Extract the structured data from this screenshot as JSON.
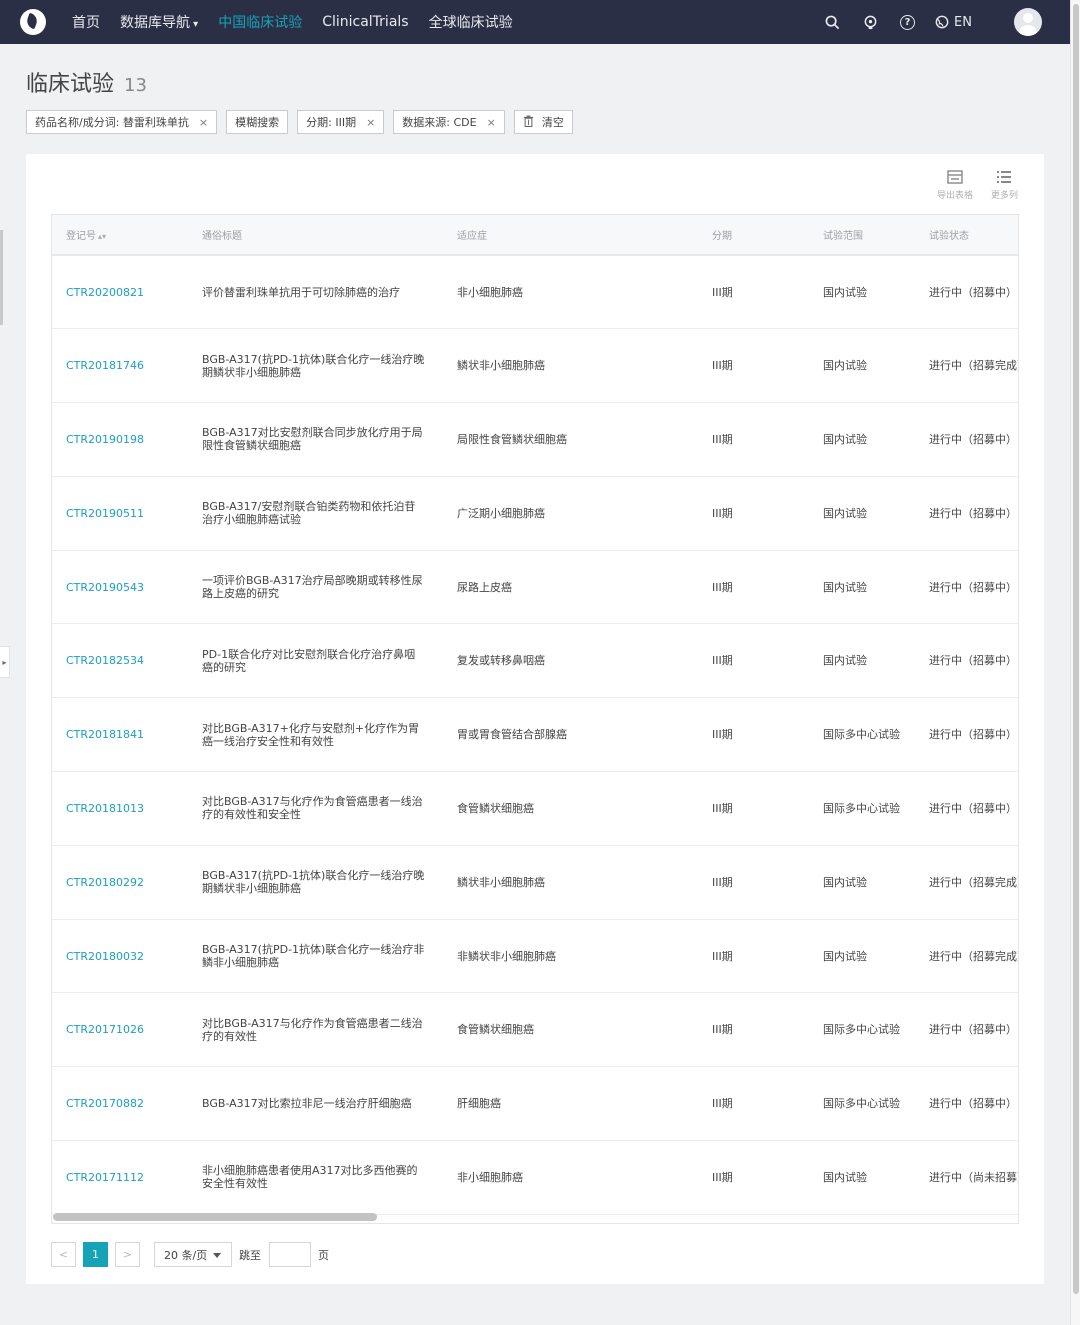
{
  "nav": {
    "items": [
      {
        "label": "首页",
        "active": false,
        "dropdown": false
      },
      {
        "label": "数据库导航",
        "active": false,
        "dropdown": true
      },
      {
        "label": "中国临床试验",
        "active": true,
        "dropdown": false
      },
      {
        "label": "ClinicalTrials",
        "active": false,
        "dropdown": false
      },
      {
        "label": "全球临床试验",
        "active": false,
        "dropdown": false
      }
    ],
    "lang_label": "EN",
    "icons": [
      "search-icon",
      "lightbulb-icon",
      "help-icon",
      "globe-icon",
      "avatar"
    ]
  },
  "page": {
    "title": "临床试验",
    "count": "13"
  },
  "filters": [
    {
      "label": "药品名称/成分词: 替雷利珠单抗",
      "removable": true
    },
    {
      "label": "模糊搜索",
      "removable": false
    },
    {
      "label": "分期: III期",
      "removable": true
    },
    {
      "label": "数据来源: CDE",
      "removable": true
    }
  ],
  "clear_label": "清空",
  "toolbar": {
    "export_label": "导出表格",
    "columns_label": "更多列"
  },
  "table": {
    "columns": [
      "登记号",
      "通俗标题",
      "适应症",
      "分期",
      "试验范围",
      "试验状态"
    ],
    "rows": [
      {
        "id": "CTR20200821",
        "title": "评价替雷利珠单抗用于可切除肺癌的治疗",
        "indication": "非小细胞肺癌",
        "phase": "III期",
        "scope": "国内试验",
        "status": "进行中（招募中）"
      },
      {
        "id": "CTR20181746",
        "title": "BGB-A317(抗PD-1抗体)联合化疗一线治疗晚期鳞状非小细胞肺癌",
        "indication": "鳞状非小细胞肺癌",
        "phase": "III期",
        "scope": "国内试验",
        "status": "进行中（招募完成）"
      },
      {
        "id": "CTR20190198",
        "title": "BGB-A317对比安慰剂联合同步放化疗用于局限性食管鳞状细胞癌",
        "indication": "局限性食管鳞状细胞癌",
        "phase": "III期",
        "scope": "国内试验",
        "status": "进行中（招募中）"
      },
      {
        "id": "CTR20190511",
        "title": "BGB-A317/安慰剂联合铂类药物和依托泊苷治疗小细胞肺癌试验",
        "indication": "广泛期小细胞肺癌",
        "phase": "III期",
        "scope": "国内试验",
        "status": "进行中（招募中）"
      },
      {
        "id": "CTR20190543",
        "title": "一项评价BGB-A317治疗局部晚期或转移性尿路上皮癌的研究",
        "indication": "尿路上皮癌",
        "phase": "III期",
        "scope": "国内试验",
        "status": "进行中（招募中）"
      },
      {
        "id": "CTR20182534",
        "title": "PD-1联合化疗对比安慰剂联合化疗治疗鼻咽癌的研究",
        "indication": "复发或转移鼻咽癌",
        "phase": "III期",
        "scope": "国内试验",
        "status": "进行中（招募中）"
      },
      {
        "id": "CTR20181841",
        "title": "对比BGB-A317+化疗与安慰剂+化疗作为胃癌一线治疗安全性和有效性",
        "indication": "胃或胃食管结合部腺癌",
        "phase": "III期",
        "scope": "国际多中心试验",
        "status": "进行中（招募中）"
      },
      {
        "id": "CTR20181013",
        "title": "对比BGB-A317与化疗作为食管癌患者一线治疗的有效性和安全性",
        "indication": "食管鳞状细胞癌",
        "phase": "III期",
        "scope": "国际多中心试验",
        "status": "进行中（招募中）"
      },
      {
        "id": "CTR20180292",
        "title": "BGB-A317(抗PD-1抗体)联合化疗一线治疗晚期鳞状非小细胞肺癌",
        "indication": "鳞状非小细胞肺癌",
        "phase": "III期",
        "scope": "国内试验",
        "status": "进行中（招募完成）"
      },
      {
        "id": "CTR20180032",
        "title": "BGB-A317(抗PD-1抗体)联合化疗一线治疗非鳞非小细胞肺癌",
        "indication": "非鳞状非小细胞肺癌",
        "phase": "III期",
        "scope": "国内试验",
        "status": "进行中（招募完成）"
      },
      {
        "id": "CTR20171026",
        "title": "对比BGB-A317与化疗作为食管癌患者二线治疗的有效性",
        "indication": "食管鳞状细胞癌",
        "phase": "III期",
        "scope": "国际多中心试验",
        "status": "进行中（招募中）"
      },
      {
        "id": "CTR20170882",
        "title": "BGB-A317对比索拉非尼一线治疗肝细胞癌",
        "indication": "肝细胞癌",
        "phase": "III期",
        "scope": "国际多中心试验",
        "status": "进行中（招募中）"
      },
      {
        "id": "CTR20171112",
        "title": "非小细胞肺癌患者使用A317对比多西他赛的安全性有效性",
        "indication": "非小细胞肺癌",
        "phase": "III期",
        "scope": "国内试验",
        "status": "进行中（尚未招募）"
      }
    ]
  },
  "pagination": {
    "prev": "<",
    "next": ">",
    "current_page": "1",
    "page_size": "20 条/页",
    "jump_label": "跳至",
    "jump_value": "",
    "page_unit": "页"
  }
}
